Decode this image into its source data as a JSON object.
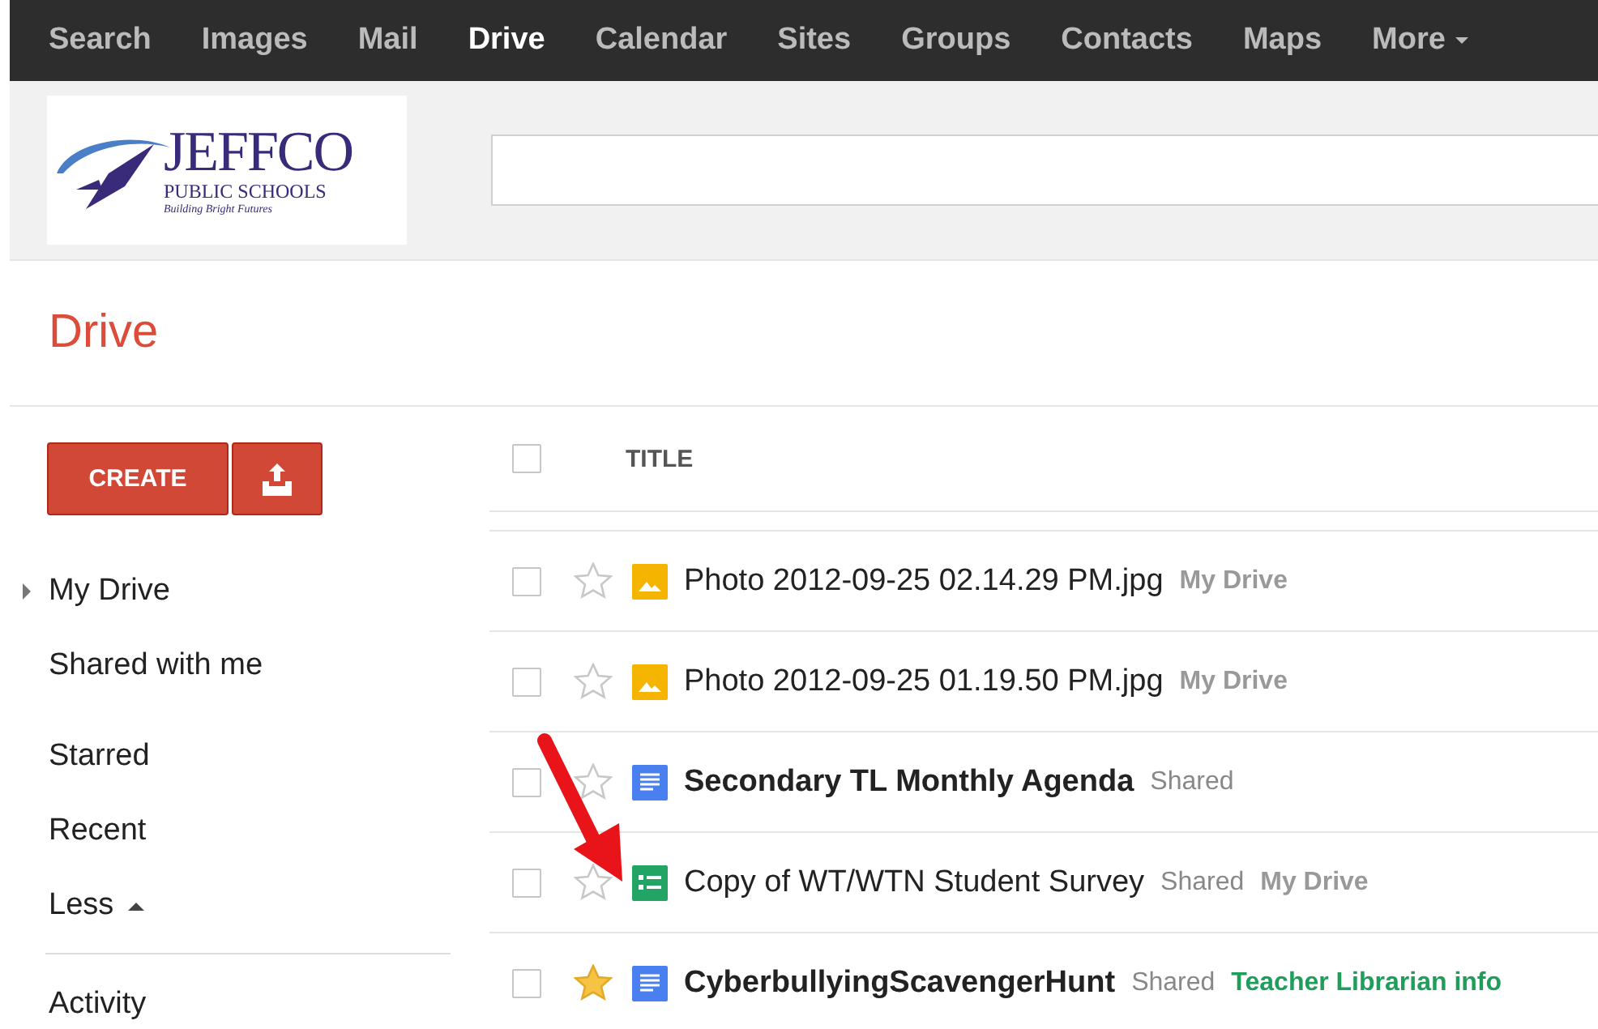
{
  "top_nav": [
    {
      "label": "Search",
      "selected": false,
      "kind": "link"
    },
    {
      "label": "Images",
      "selected": false,
      "kind": "link"
    },
    {
      "label": "Mail",
      "selected": false,
      "kind": "link"
    },
    {
      "label": "Drive",
      "selected": true,
      "kind": "link"
    },
    {
      "label": "Calendar",
      "selected": false,
      "kind": "link"
    },
    {
      "label": "Sites",
      "selected": false,
      "kind": "link"
    },
    {
      "label": "Groups",
      "selected": false,
      "kind": "link"
    },
    {
      "label": "Contacts",
      "selected": false,
      "kind": "link"
    },
    {
      "label": "Maps",
      "selected": false,
      "kind": "link"
    },
    {
      "label": "More",
      "selected": false,
      "kind": "menu"
    }
  ],
  "logo": {
    "name": "JEFFCO",
    "subtitle": "PUBLIC SCHOOLS",
    "tagline": "Building Bright Futures"
  },
  "page_title": "Drive",
  "create_button": "CREATE",
  "sidebar": {
    "groups": [
      [
        {
          "label": "My Drive",
          "kind": "tree"
        },
        {
          "label": "Shared with me",
          "kind": "plain"
        }
      ],
      [
        {
          "label": "Starred",
          "kind": "plain"
        },
        {
          "label": "Recent",
          "kind": "plain"
        },
        {
          "label": "Less",
          "kind": "toggle"
        }
      ]
    ],
    "footer_items": [
      "Activity"
    ]
  },
  "table": {
    "all_checked": false,
    "columns": [
      "TITLE"
    ],
    "rows": [
      {
        "title": "Photo 2012-09-25 02.14.29 PM.jpg",
        "kind": "image",
        "starred": false,
        "checked": false,
        "unread": false,
        "tags": [
          {
            "label": "My Drive",
            "kind": "folder"
          }
        ]
      },
      {
        "title": "Photo 2012-09-25 01.19.50 PM.jpg",
        "kind": "image",
        "starred": false,
        "checked": false,
        "unread": false,
        "tags": [
          {
            "label": "My Drive",
            "kind": "folder"
          }
        ]
      },
      {
        "title": "Secondary TL Monthly Agenda",
        "kind": "document",
        "starred": false,
        "checked": false,
        "unread": true,
        "tags": [
          {
            "label": "Shared",
            "kind": "status"
          }
        ]
      },
      {
        "title": "Copy of WT/WTN Student Survey",
        "kind": "form",
        "starred": false,
        "checked": false,
        "unread": false,
        "tags": [
          {
            "label": "Shared",
            "kind": "status"
          },
          {
            "label": "My Drive",
            "kind": "folder"
          }
        ]
      },
      {
        "title": "CyberbullyingScavengerHunt",
        "kind": "document",
        "starred": true,
        "checked": false,
        "unread": true,
        "tags": [
          {
            "label": "Shared",
            "kind": "status"
          },
          {
            "label": "Teacher Librarian info",
            "kind": "folder",
            "color": "#1e9e5a"
          }
        ]
      }
    ]
  }
}
